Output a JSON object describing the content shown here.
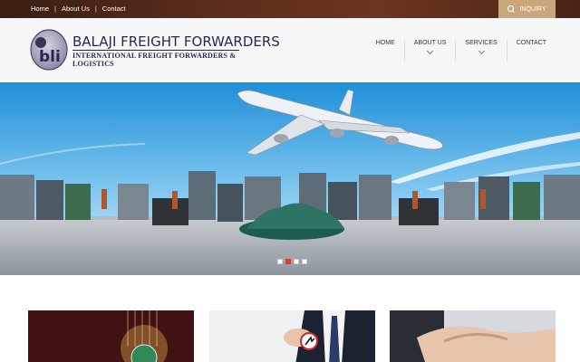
{
  "topbar": {
    "links": [
      "Home",
      "About Us",
      "Contact"
    ],
    "separator": "|",
    "inquiry_label": "INQUIRY",
    "inquiry_icon": "search-icon",
    "colors": {
      "bar": "#5a2c1a",
      "inquiry": "#c9a77a"
    }
  },
  "header": {
    "logo_mark_text": "bli",
    "logo_title": "BALAJI FREIGHT FORWARDERS",
    "logo_subtitle": "INTERNATIONAL FREIGHT FORWARDERS & LOGISTICS",
    "nav": [
      {
        "label": "HOME"
      },
      {
        "label": "ABOUT US",
        "dropdown": true
      },
      {
        "label": "SERVICES",
        "dropdown": true
      },
      {
        "label": "CONTACT"
      }
    ],
    "colors": {
      "brand": "#242a55"
    }
  },
  "slider": {
    "slide_count": 4,
    "active_index": 1,
    "colors": {
      "active": "#e23b2e"
    }
  },
  "cards": [
    {
      "image": "globe-tech"
    },
    {
      "image": "businessman-arrow"
    },
    {
      "image": "handshake"
    }
  ]
}
